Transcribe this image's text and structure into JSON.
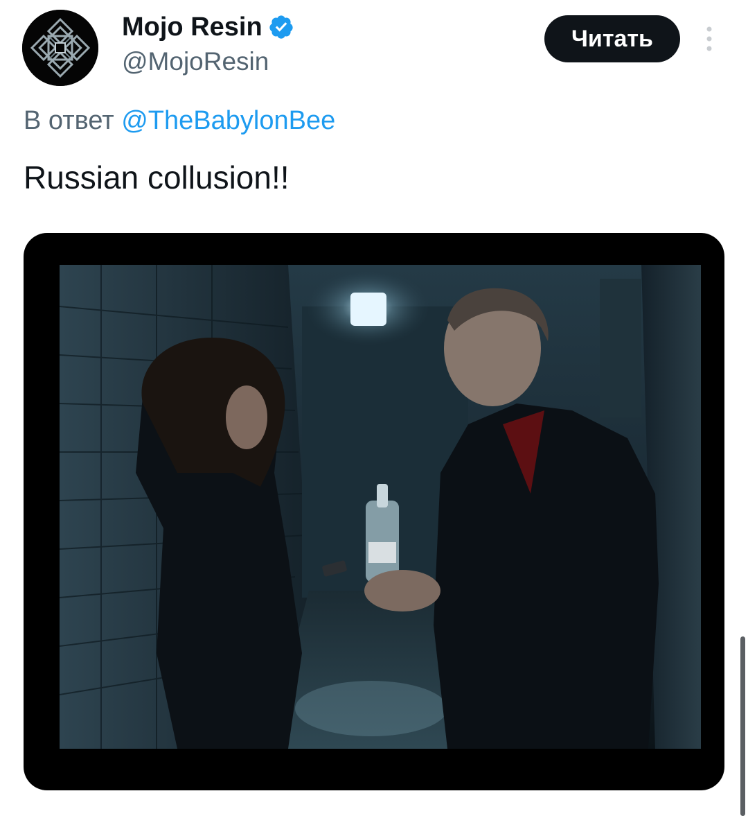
{
  "tweet": {
    "author": {
      "display_name": "Mojo Resin",
      "handle": "@MojoResin",
      "verified": true,
      "avatar_icon": "celtic-knot-logo"
    },
    "follow_button_label": "Читать",
    "more_icon": "vertical-ellipsis-icon",
    "reply_to": {
      "prefix": "В ответ",
      "mention": "@TheBabylonBee"
    },
    "text": "Russian collusion!!",
    "media": {
      "type": "image",
      "subject": "two-figures-dim-corridor-vodka-bottle"
    }
  },
  "colors": {
    "text_primary": "#0f1419",
    "text_secondary": "#536471",
    "link": "#1d9bf0",
    "verified_badge": "#1d9bf0",
    "follow_button_bg": "#0f1419",
    "media_frame": "#000000"
  }
}
